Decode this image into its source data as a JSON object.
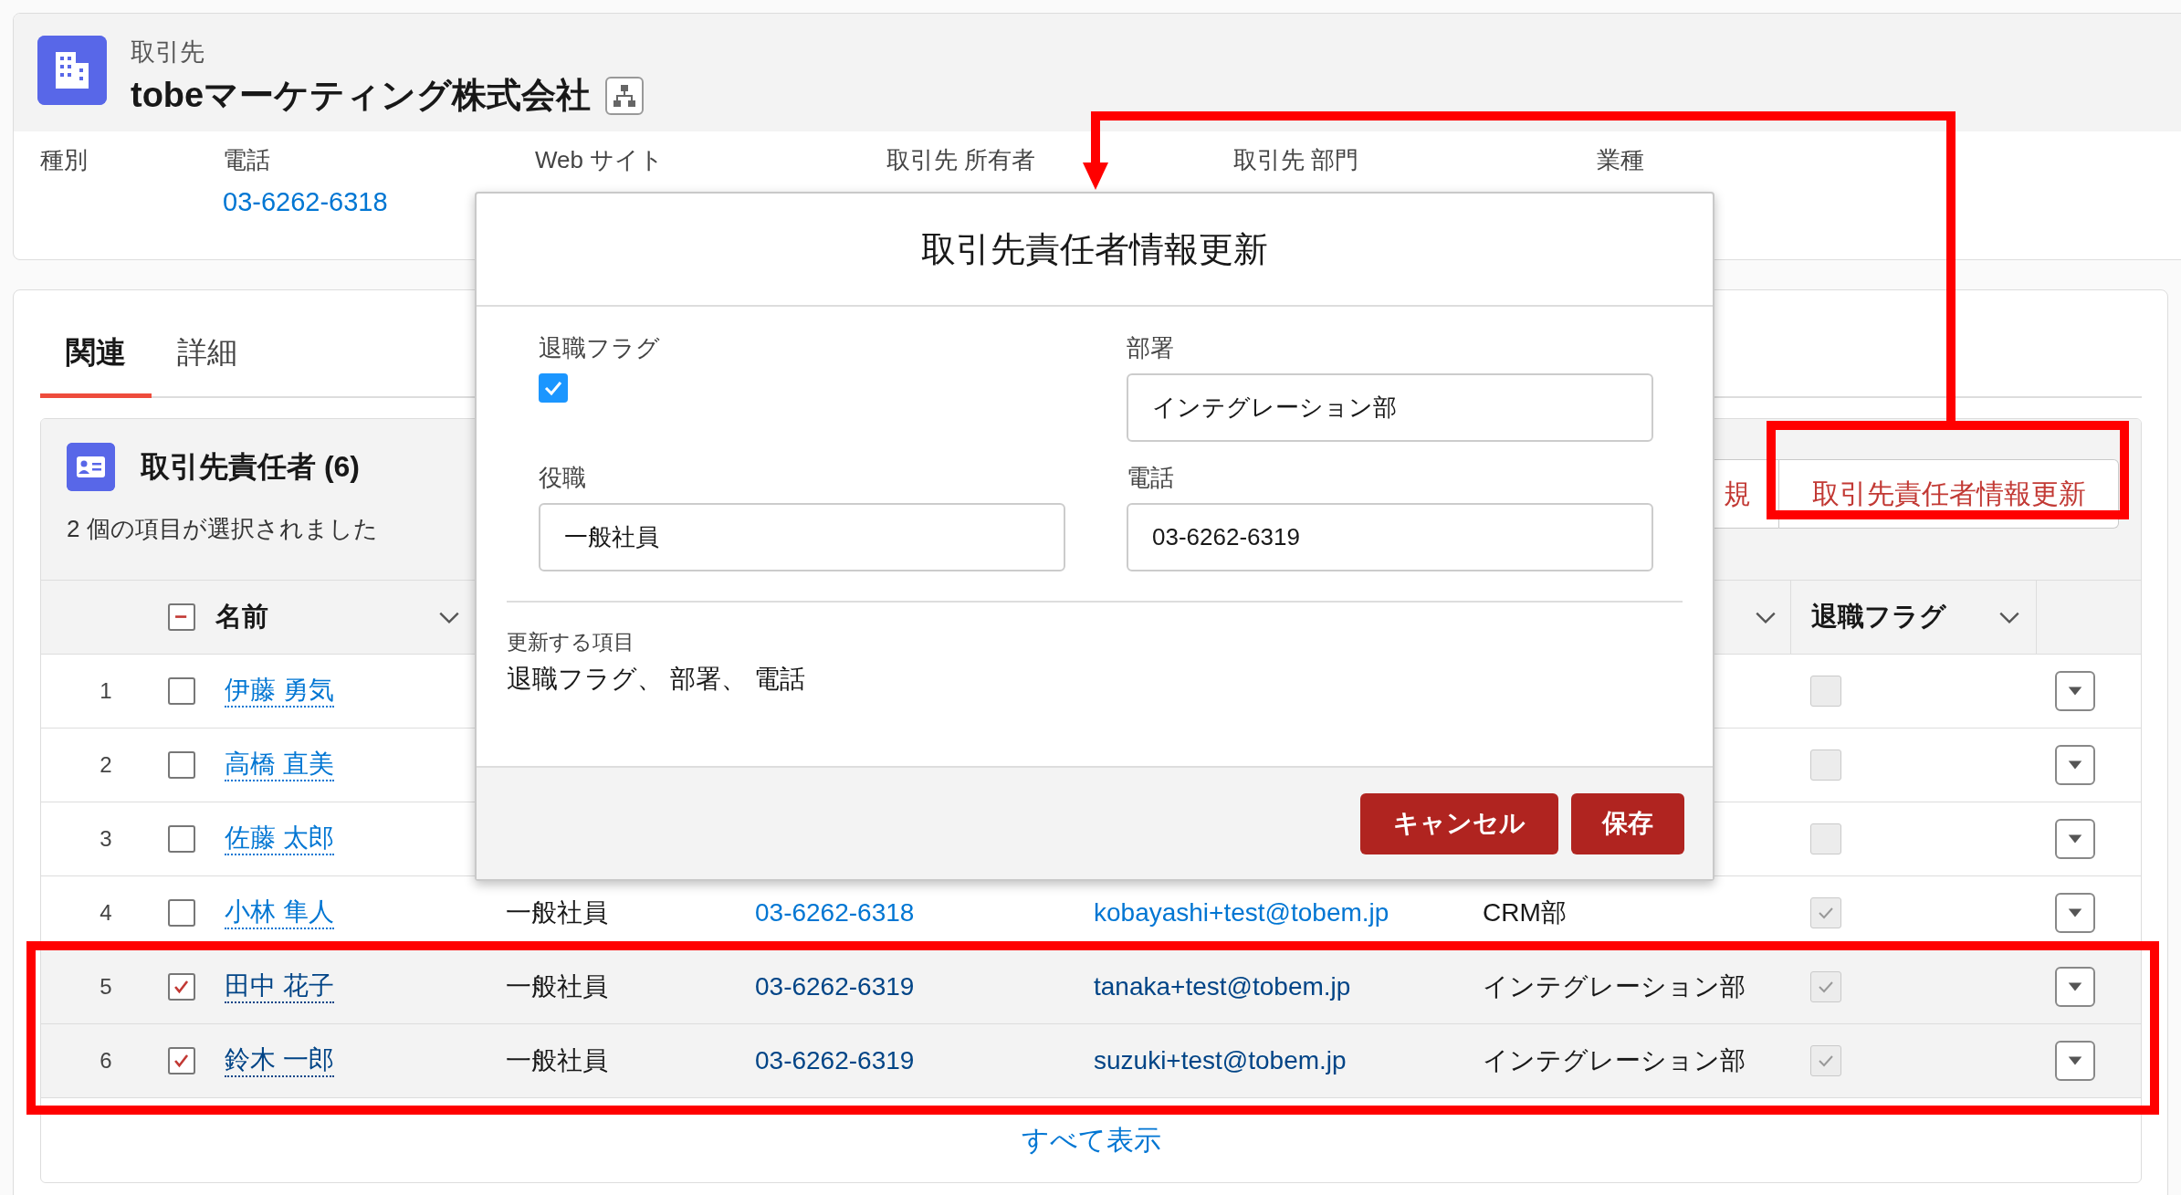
{
  "record": {
    "type_label": "取引先",
    "name": "tobeマーケティング株式会社"
  },
  "fields": [
    {
      "label": "種別"
    },
    {
      "label": "電話",
      "value": "03-6262-6318"
    },
    {
      "label": "Web サイト"
    },
    {
      "label": "取引先 所有者"
    },
    {
      "label": "取引先 部門"
    },
    {
      "label": "業種"
    }
  ],
  "tabs": [
    {
      "label": "関連",
      "selected": true
    },
    {
      "label": "詳細",
      "selected": false
    }
  ],
  "related_list": {
    "title": "取引先責任者 (6)",
    "selection_info": "2 個の項目が選択されました",
    "buttons": [
      {
        "label": "規"
      },
      {
        "label": "取引先責任者情報更新"
      }
    ],
    "select_all_indeterminate": true,
    "name_column": "名前",
    "flag_column": "退職フラグ",
    "rows": [
      {
        "number": "1",
        "selected": false,
        "name": "伊藤 勇気",
        "retired": false
      },
      {
        "number": "2",
        "selected": false,
        "name": "高橋 直美",
        "retired": false
      },
      {
        "number": "3",
        "selected": false,
        "name": "佐藤 太郎",
        "retired": false
      },
      {
        "number": "4",
        "selected": false,
        "name": "小林 隼人",
        "role": "一般社員",
        "phone": "03-6262-6318",
        "email": "kobayashi+test@tobem.jp",
        "department": "CRM部",
        "retired": true
      },
      {
        "number": "5",
        "selected": true,
        "name": "田中 花子",
        "role": "一般社員",
        "phone": "03-6262-6319",
        "email": "tanaka+test@tobem.jp",
        "department": "インテグレーション部",
        "retired": true
      },
      {
        "number": "6",
        "selected": true,
        "name": "鈴木 一郎",
        "role": "一般社員",
        "phone": "03-6262-6319",
        "email": "suzuki+test@tobem.jp",
        "department": "インテグレーション部",
        "retired": true
      }
    ],
    "view_all": "すべて表示"
  },
  "modal": {
    "title": "取引先責任者情報更新",
    "fields": [
      {
        "label": "退職フラグ",
        "kind": "checkbox",
        "checked": true
      },
      {
        "label": "部署",
        "kind": "text",
        "value": "インテグレーション部"
      },
      {
        "label": "役職",
        "kind": "text",
        "value": "一般社員"
      },
      {
        "label": "電話",
        "kind": "text",
        "value": "03-6262-6319"
      }
    ],
    "update_caption": "更新する項目",
    "update_items": "退職フラグ、 部署、 電話",
    "buttons": [
      {
        "label": "キャンセル"
      },
      {
        "label": "保存"
      }
    ]
  }
}
